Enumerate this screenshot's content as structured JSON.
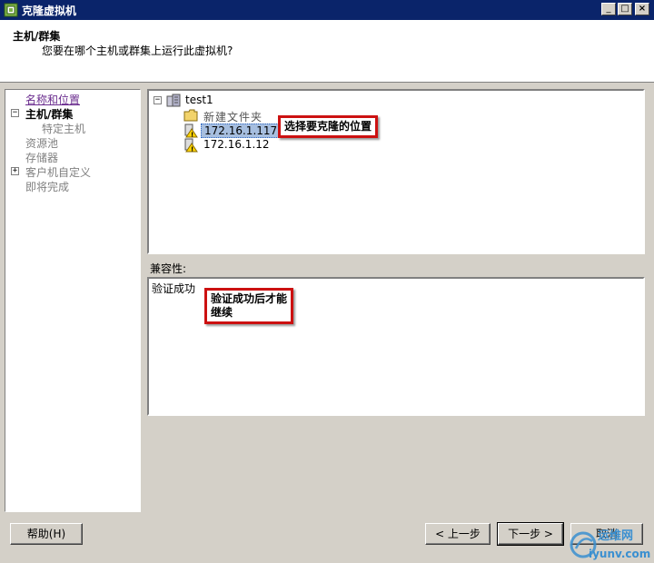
{
  "window": {
    "title": "克隆虚拟机",
    "min_label": "_",
    "max_label": "□",
    "close_label": "×"
  },
  "header": {
    "title": "主机/群集",
    "subtitle": "您要在哪个主机或群集上运行此虚拟机?"
  },
  "steps": [
    {
      "label": "名称和位置",
      "state": "link"
    },
    {
      "label": "主机/群集",
      "state": "current",
      "expander": "⊟"
    },
    {
      "label": "特定主机",
      "state": "grey"
    },
    {
      "label": "资源池",
      "state": "grey"
    },
    {
      "label": "存储器",
      "state": "grey"
    },
    {
      "label": "客户机自定义",
      "state": "grey",
      "expander": "⊞"
    },
    {
      "label": "即将完成",
      "state": "grey"
    }
  ],
  "tree": {
    "root": "test1",
    "folder": "新建文件夹",
    "hosts": [
      "172.16.1.117",
      "172.16.1.12"
    ]
  },
  "callouts": {
    "location": "选择要克隆的位置",
    "verify_line1": "验证成功后才能",
    "verify_line2": "继续"
  },
  "compatibility": {
    "label": "兼容性:",
    "message": "验证成功"
  },
  "buttons": {
    "help": "帮助(H)",
    "back": "< 上一步",
    "next": "下一步 >",
    "cancel": "取消"
  },
  "watermark": {
    "text": "运维网",
    "url": "iyunv.com"
  }
}
